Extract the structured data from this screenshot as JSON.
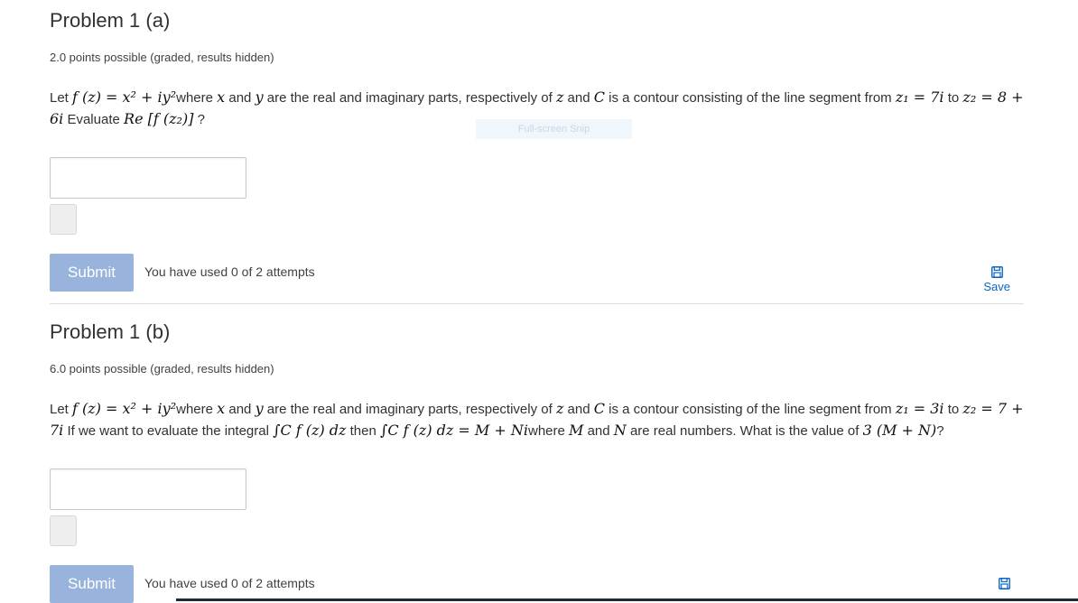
{
  "problem_a": {
    "title": "Problem 1 (a)",
    "points": "2.0 points possible (graded, results hidden)",
    "stmt": {
      "t1": "Let ",
      "m1": "f (z) = x² + iy²",
      "t2": "where ",
      "m2": "x",
      "t3": " and ",
      "m3": "y",
      "t4": " are the real and imaginary parts, respectively of ",
      "m4": "z",
      "t5": " and ",
      "m5": "C",
      "t6": " is a contour consisting of the line segment from ",
      "m6": "z₁ = 7i",
      "t7": " to ",
      "m7": "z₂ = 8 + 6i",
      "t8": " Evaluate ",
      "m8": "Re [f (z₂)]",
      "t9": " ?"
    },
    "submit_label": "Submit",
    "attempts": "You have used 0 of 2 attempts",
    "save_label": "Save"
  },
  "problem_b": {
    "title": "Problem 1 (b)",
    "points": "6.0 points possible (graded, results hidden)",
    "stmt": {
      "t1": "Let ",
      "m1": "f (z) = x² + iy²",
      "t2": "where ",
      "m2": "x",
      "t3": " and ",
      "m3": "y",
      "t4": " are the real and imaginary parts, respectively of ",
      "m4": "z",
      "t5": " and ",
      "m5": "C",
      "t6": " is a contour consisting of the line segment from ",
      "m6": "z₁ = 3i",
      "t7": " to ",
      "m7": "z₂ = 7 + 7i",
      "t8": " If we want to evaluate the integral ",
      "m8": "∫C f (z) dz",
      "t9": " then ",
      "m9": "∫C f (z) dz = M + Ni",
      "t10": "where ",
      "m10": "M",
      "t11": " and ",
      "m11": "N",
      "t12": " are real numbers. What is the value of ",
      "m12": "3 (M + N)",
      "t13": "?"
    },
    "submit_label": "Submit",
    "attempts": "You have used 0 of 2 attempts"
  },
  "overlay": {
    "snip_label": "Full-screen Snip"
  },
  "colors": {
    "accent": "#0a66c2",
    "submit_bg": "#98b4dd",
    "divider": "#dddddd"
  },
  "icons": {
    "save": "floppy-disk-icon"
  }
}
